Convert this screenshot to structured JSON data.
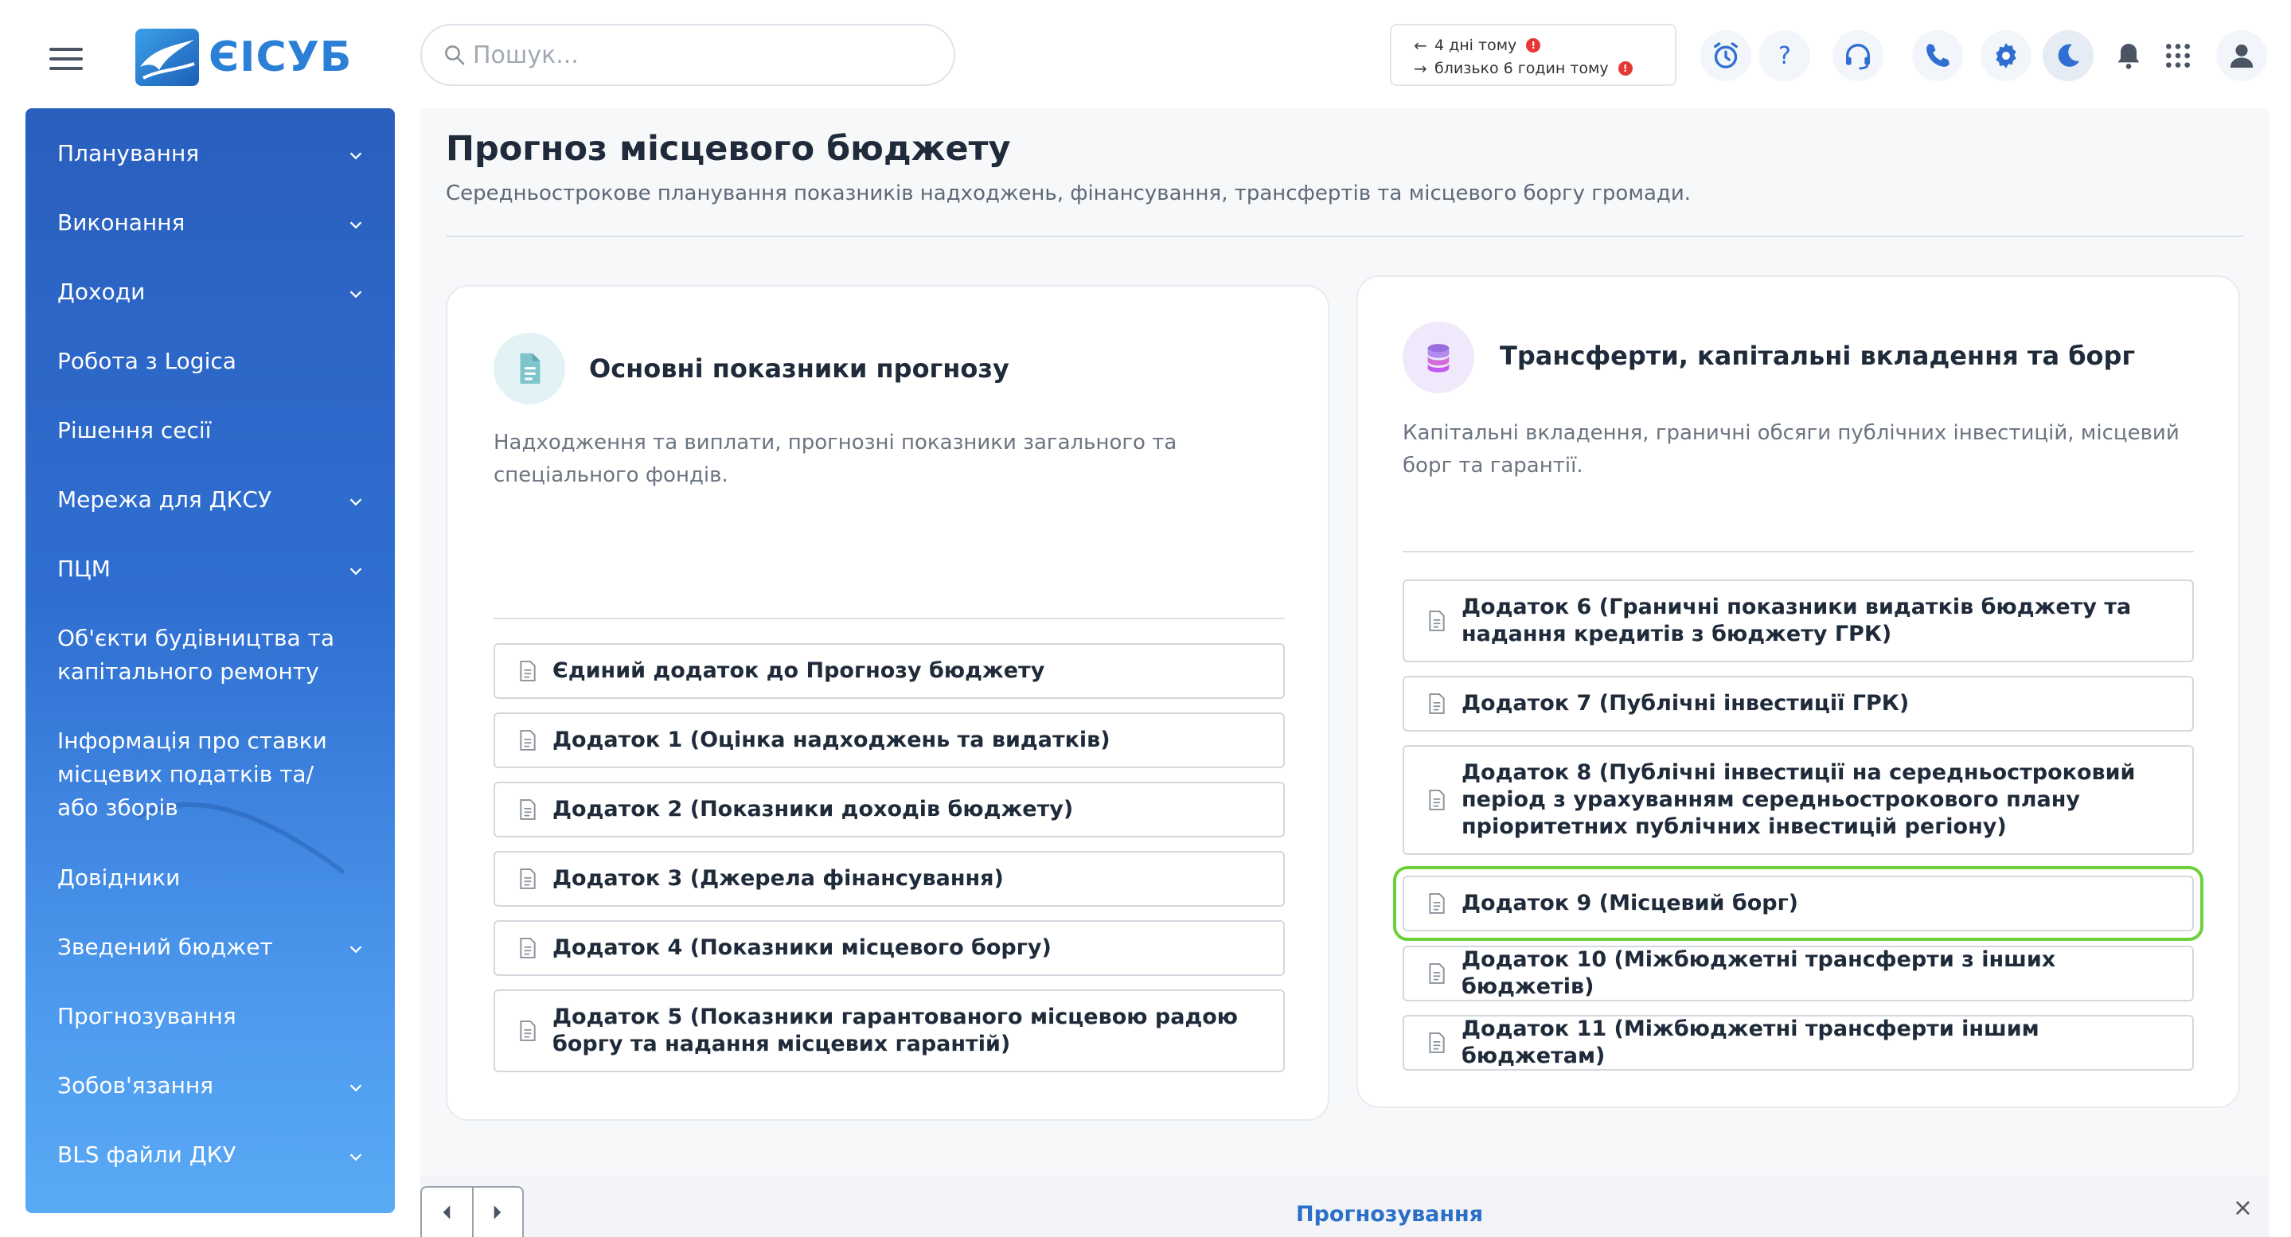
{
  "header": {
    "logo_text": "ЄІСУБ",
    "search_placeholder": "Пошук...",
    "history": [
      {
        "direction": "back",
        "label": "4 дні тому",
        "badge": "!"
      },
      {
        "direction": "forward",
        "label": "близько 6 годин тому",
        "badge": "!"
      }
    ],
    "icons": [
      "alarm-clock-icon",
      "help-icon",
      "headset-icon",
      "phone-icon",
      "gear-icon",
      "moon-icon",
      "bell-icon",
      "apps-grid-icon",
      "user-icon"
    ]
  },
  "sidebar": {
    "items": [
      {
        "label": "Планування",
        "expandable": true
      },
      {
        "label": "Виконання",
        "expandable": true
      },
      {
        "label": "Доходи",
        "expandable": true
      },
      {
        "label": "Робота з Logica",
        "expandable": false
      },
      {
        "label": "Рішення сесії",
        "expandable": false
      },
      {
        "label": "Мережа для ДКСУ",
        "expandable": true
      },
      {
        "label": "ПЦМ",
        "expandable": true
      },
      {
        "label": "Об'єкти будівництва та капітального ремонту",
        "expandable": false
      },
      {
        "label": "Інформація про ставки місцевих податків та/або зборів",
        "expandable": false
      },
      {
        "label": "Довідники",
        "expandable": false
      },
      {
        "label": "Зведений бюджет",
        "expandable": true
      },
      {
        "label": "Прогнозування",
        "expandable": false
      },
      {
        "label": "Зобов'язання",
        "expandable": true
      },
      {
        "label": "BLS файли ДКУ",
        "expandable": true
      }
    ]
  },
  "main": {
    "title": "Прогноз місцевого бюджету",
    "subtitle": "Середньострокове планування показників надходжень, фінансування, трансфертів та місцевого боргу громади.",
    "cards": [
      {
        "title": "Основні показники прогнозу",
        "description": "Надходження та виплати, прогнозні показники загального та спеціального фондів.",
        "icon": "document-icon",
        "buttons": [
          {
            "label": "Єдиний додаток до Прогнозу бюджету"
          },
          {
            "label": "Додаток 1 (Оцінка надходжень та видатків)"
          },
          {
            "label": "Додаток 2 (Показники доходів бюджету)"
          },
          {
            "label": "Додаток 3 (Джерела фінансування)"
          },
          {
            "label": "Додаток 4 (Показники місцевого боргу)"
          },
          {
            "label": "Додаток 5 (Показники гарантованого місцевою радою боргу та надання місцевих гарантій)"
          }
        ]
      },
      {
        "title": "Трансферти, капітальні вкладення та борг",
        "description": "Капітальні вкладення, граничні обсяги публічних інвестицій, місцевий борг та гарантії.",
        "icon": "coins-stack-icon",
        "buttons": [
          {
            "label": "Додаток 6 (Граничні показники видатків бюджету та надання кредитів з бюджету ГРК)"
          },
          {
            "label": "Додаток 7 (Публічні інвестиції ГРК)"
          },
          {
            "label": "Додаток 8 (Публічні інвестиції на середньостроковий період з урахуванням середньострокового плану пріоритетних публічних інвестицій регіону)"
          },
          {
            "label": "Додаток 9 (Місцевий борг)",
            "highlighted": true
          },
          {
            "label": "Додаток 10 (Міжбюджетні трансферти з інших бюджетів)"
          },
          {
            "label": "Додаток 11 (Міжбюджетні трансферти іншим бюджетам)"
          }
        ]
      }
    ]
  },
  "bottom_bar": {
    "tab_label": "Прогнозування",
    "close_label": "×"
  },
  "colors": {
    "accent": "#2a7fd6",
    "sidebar_top": "#2a5fbe",
    "sidebar_bottom": "#5aaaf5",
    "highlight_outline": "#6bd13b",
    "alert_badge": "#e53935"
  }
}
